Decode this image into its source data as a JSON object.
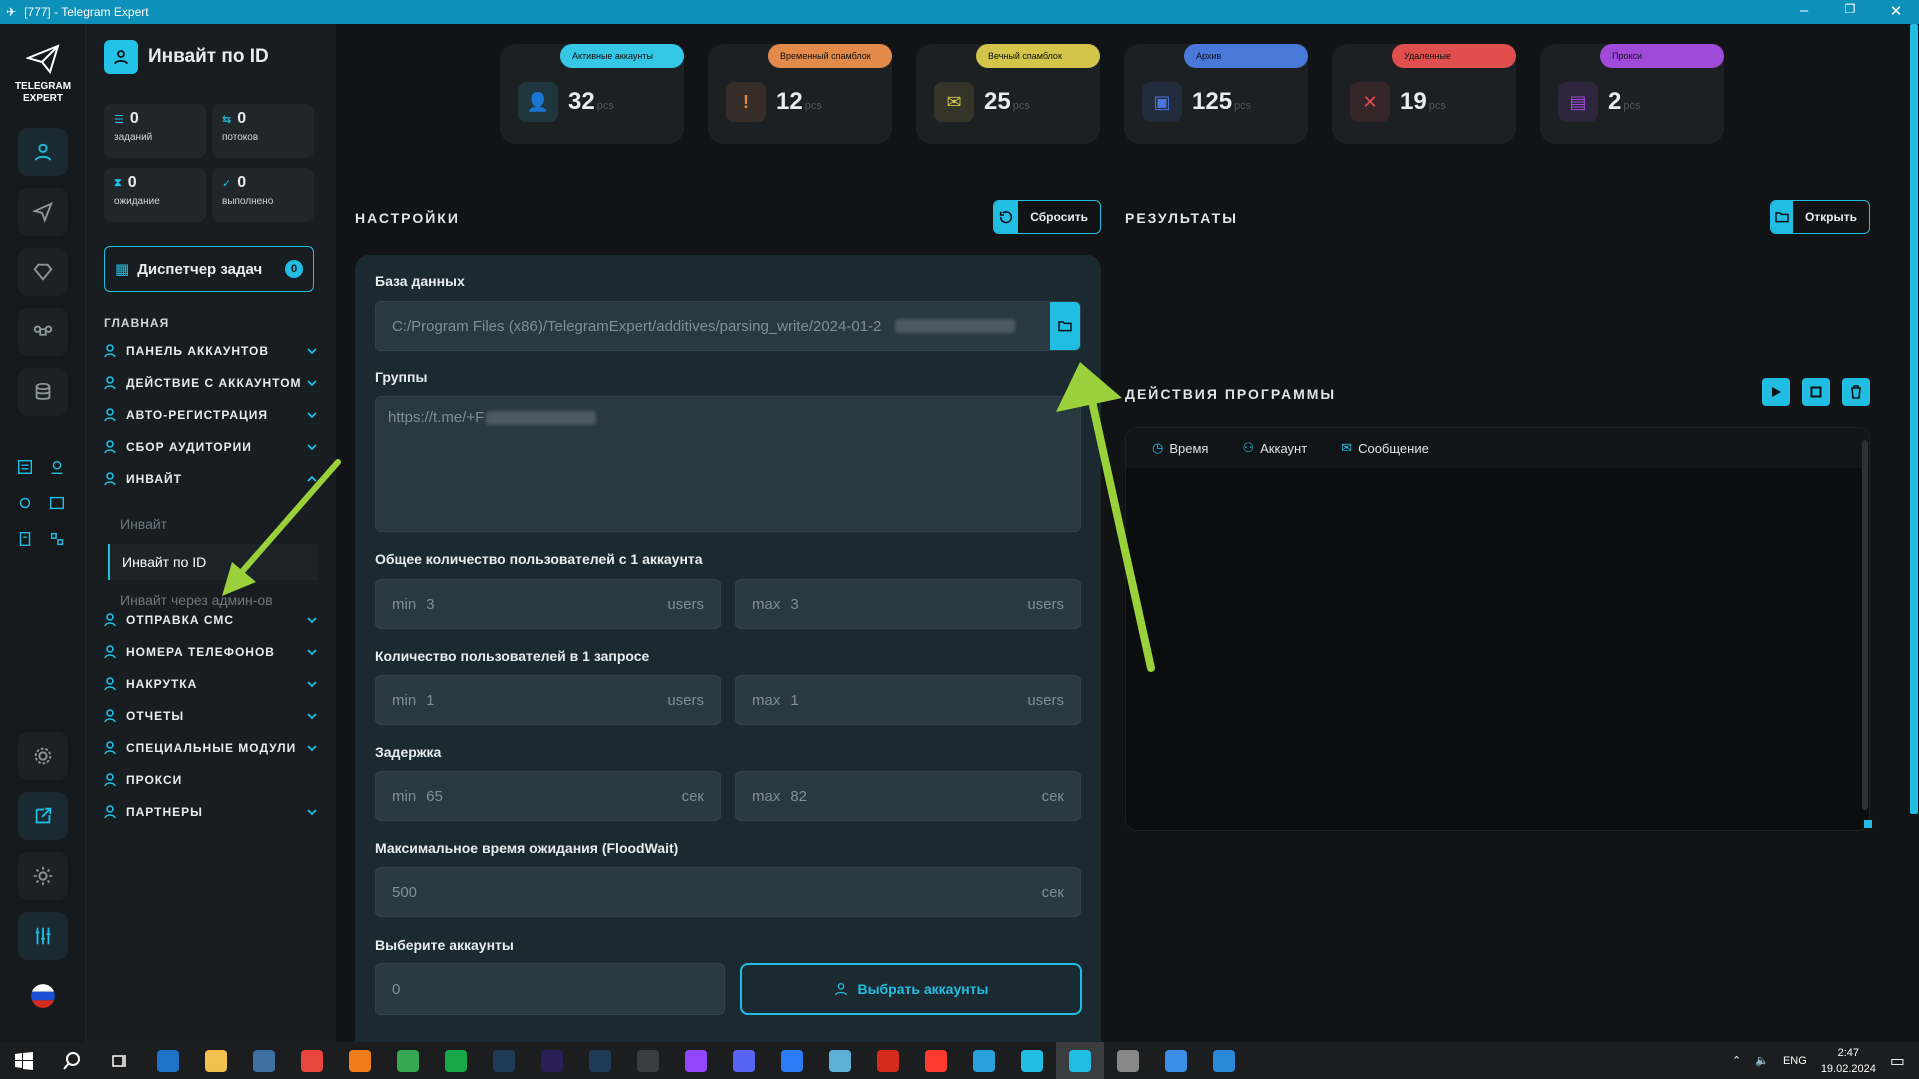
{
  "window": {
    "title": "[777] - Telegram Expert"
  },
  "logo": {
    "line1": "TELEGRAM",
    "line2": "EXPERT"
  },
  "section": {
    "title": "Инвайт по ID"
  },
  "stats": [
    {
      "value": "0",
      "label": "заданий",
      "icon": "tasks-icon"
    },
    {
      "value": "0",
      "label": "потоков",
      "icon": "threads-icon"
    },
    {
      "value": "0",
      "label": "ожидание",
      "icon": "hourglass-icon"
    },
    {
      "value": "0",
      "label": "выполнено",
      "icon": "check-icon"
    }
  ],
  "dispatcher": {
    "label": "Диспетчер задач",
    "count": "0"
  },
  "nav": {
    "heading": "ГЛАВНАЯ",
    "items": [
      {
        "label": "ПАНЕЛЬ АККАУНТОВ"
      },
      {
        "label": "ДЕЙСТВИЕ С АККАУНТОМ"
      },
      {
        "label": "АВТО-РЕГИСТРАЦИЯ"
      },
      {
        "label": "СБОР АУДИТОРИИ"
      },
      {
        "label": "ИНВАЙТ"
      },
      {
        "label": "ОТПРАВКА СМС"
      },
      {
        "label": "НОМЕРА ТЕЛЕФОНОВ"
      },
      {
        "label": "НАКРУТКА"
      },
      {
        "label": "ОТЧЕТЫ"
      },
      {
        "label": "СПЕЦИАЛЬНЫЕ МОДУЛИ"
      },
      {
        "label": "ПРОКСИ"
      },
      {
        "label": "ПАРТНЕРЫ"
      }
    ],
    "sub": [
      {
        "label": "Инвайт"
      },
      {
        "label": "Инвайт по ID"
      },
      {
        "label": "Инвайт через админ-ов"
      }
    ]
  },
  "kpis": [
    {
      "badge": "Активные аккаунты",
      "value": "32",
      "unit": "pcs",
      "color": "#35c7e6"
    },
    {
      "badge": "Временный спамблок",
      "value": "12",
      "unit": "pcs",
      "color": "#e18a4a"
    },
    {
      "badge": "Вечный спамблок",
      "value": "25",
      "unit": "pcs",
      "color": "#d3c44a"
    },
    {
      "badge": "Архив",
      "value": "125",
      "unit": "pcs",
      "color": "#4a78d9"
    },
    {
      "badge": "Удаленные",
      "value": "19",
      "unit": "pcs",
      "color": "#e14e4e"
    },
    {
      "badge": "Прокси",
      "value": "2",
      "unit": "pcs",
      "color": "#a04ad9"
    }
  ],
  "settings": {
    "title": "НАСТРОЙКИ",
    "reset": "Сбросить",
    "db_label": "База данных",
    "db_value": "C:/Program Files (x86)/TelegramExpert/additives/parsing_write/2024-01-2",
    "groups_label": "Группы",
    "groups_value": "https://t.me/+F",
    "total_label": "Общее количество пользователей с 1 аккаунта",
    "total_min": "3",
    "total_max": "3",
    "perreq_label": "Количество пользователей в 1 запросе",
    "perreq_min": "1",
    "perreq_max": "1",
    "delay_label": "Задержка",
    "delay_min": "65",
    "delay_max": "82",
    "flood_label": "Максимальное время ожидания (FloodWait)",
    "flood_value": "500",
    "accounts_label": "Выберите аккаунты",
    "accounts_value": "0",
    "accounts_btn": "Выбрать аккаунты",
    "min": "min",
    "max": "max",
    "users": "users",
    "sec": "сек"
  },
  "results": {
    "title": "РЕЗУЛЬТАТЫ",
    "open": "Открыть"
  },
  "actions": {
    "title": "ДЕЙСТВИЯ ПРОГРАММЫ",
    "cols": [
      "Время",
      "Аккаунт",
      "Сообщение"
    ]
  },
  "tray": {
    "lang": "ENG",
    "time": "2:47",
    "date": "19.02.2024"
  }
}
